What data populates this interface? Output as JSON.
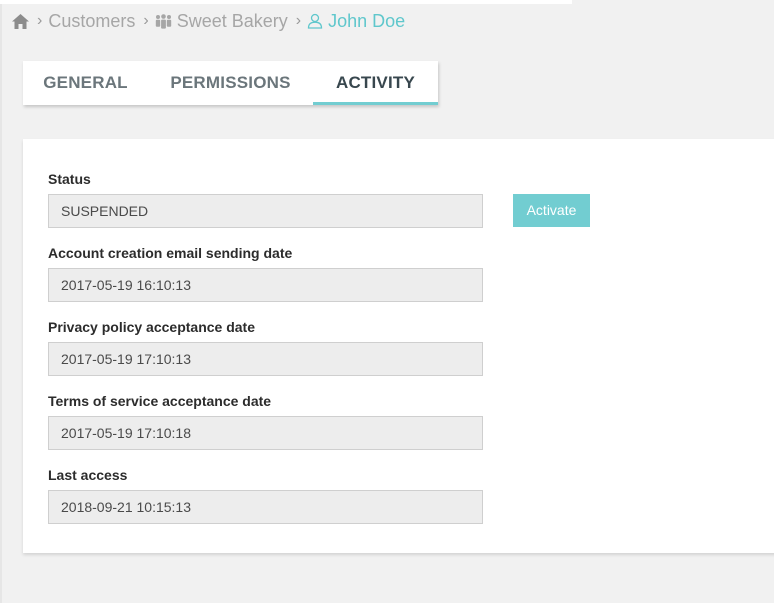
{
  "breadcrumb": {
    "items": [
      {
        "label": "Customers"
      },
      {
        "label": "Sweet Bakery"
      },
      {
        "label": "John Doe"
      }
    ],
    "separator": "›",
    "colors": {
      "active": "#5fc7cc",
      "inactive": "#a6a6a6"
    },
    "icons": [
      "home-icon",
      "group-icon",
      "user-icon"
    ]
  },
  "tabs": [
    {
      "label": "GENERAL",
      "active": false
    },
    {
      "label": "PERMISSIONS",
      "active": false
    },
    {
      "label": "ACTIVITY",
      "active": true
    }
  ],
  "form": {
    "status": {
      "label": "Status",
      "value": "SUSPENDED"
    },
    "activate_button": "Activate",
    "account_creation": {
      "label": "Account creation email sending date",
      "value": "2017-05-19 16:10:13"
    },
    "privacy_policy": {
      "label": "Privacy policy acceptance date",
      "value": "2017-05-19 17:10:13"
    },
    "terms_of_service": {
      "label": "Terms of service acceptance date",
      "value": "2017-05-19 17:10:18"
    },
    "last_access": {
      "label": "Last access",
      "value": "2018-09-21 10:15:13"
    }
  },
  "colors": {
    "accent": "#72cdd1",
    "background": "#f1f1f1"
  }
}
